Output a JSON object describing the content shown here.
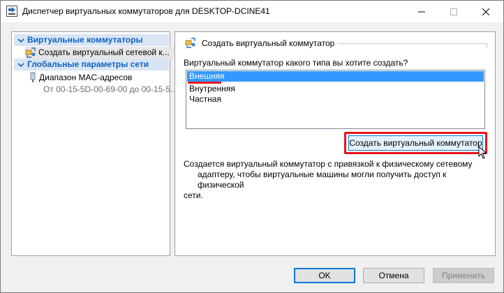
{
  "window": {
    "title": "Диспетчер виртуальных коммутаторов для DESKTOP-DCINE41",
    "icon": "switch-manager-icon",
    "controls": {
      "minimize": "—",
      "maximize": "☐",
      "close": "✕"
    }
  },
  "tree": {
    "section1": {
      "label": "Виртуальные коммутаторы",
      "icon": "chevron-down-icon"
    },
    "section1_items": [
      {
        "label": "Создать виртуальный сетевой к...",
        "icon": "network-switch-icon"
      }
    ],
    "section2": {
      "label": "Глобальные параметры сети",
      "icon": "chevron-down-icon"
    },
    "section2_items": [
      {
        "label": "Диапазон MAC-адресов",
        "sublabel": "От 00-15-5D-00-69-00 до 00-15-5...",
        "icon": "network-adapter-icon"
      }
    ]
  },
  "main": {
    "group_title": "Создать виртуальный коммутатор",
    "question": "Виртуальный коммутатор какого типа вы хотите создать?",
    "options": [
      "Внешняя",
      "Внутренняя",
      "Частная"
    ],
    "selected_option": "Внешняя",
    "create_button": "Создать виртуальный коммутатор",
    "description": [
      "Создается виртуальный коммутатор с привязкой к физическому сетевому",
      "адаптеру, чтобы виртуальные машины могли получить доступ к физической",
      "сети."
    ]
  },
  "footer": {
    "ok": "OK",
    "cancel": "Отмена",
    "apply": "Применить"
  },
  "colors": {
    "selection": "#3399ff",
    "highlight_annotation": "#e8131a",
    "tree_header": "#1061c0"
  }
}
